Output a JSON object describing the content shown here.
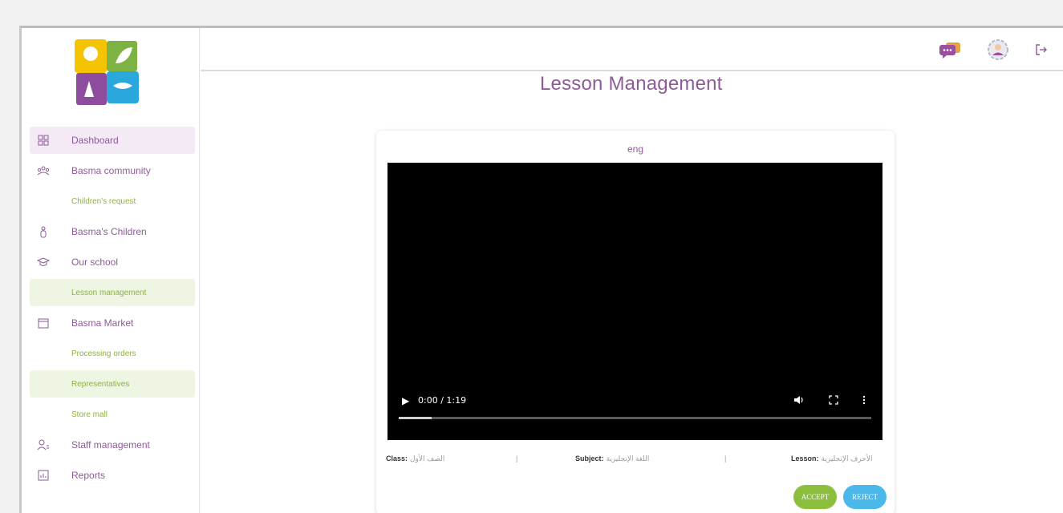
{
  "colors": {
    "brand_purple": "#8e5a98",
    "brand_green": "#8db33a",
    "accept": "#8bbf3d",
    "reject": "#4ab8e8"
  },
  "sidebar": {
    "logo": "bosma-logo",
    "items": [
      {
        "label": "Dashboard",
        "icon": "dashboard-icon",
        "sub": false,
        "active": true
      },
      {
        "label": "Basma community",
        "icon": "community-icon",
        "sub": false
      },
      {
        "label": "Children's request",
        "sub": true
      },
      {
        "label": "Basma's Children",
        "icon": "child-icon",
        "sub": false
      },
      {
        "label": "Our school",
        "icon": "school-icon",
        "sub": false
      },
      {
        "label": "Lesson management",
        "sub": true,
        "active": true
      },
      {
        "label": "Basma Market",
        "icon": "market-icon",
        "sub": false
      },
      {
        "label": "Processing orders",
        "sub": true
      },
      {
        "label": "Representatives",
        "sub": true,
        "active": true
      },
      {
        "label": "Store mall",
        "sub": true
      },
      {
        "label": "Staff management",
        "icon": "staff-icon",
        "sub": false
      },
      {
        "label": "Reports",
        "icon": "reports-icon",
        "sub": false
      }
    ]
  },
  "topbar": {
    "icons": [
      "chat-icon",
      "profile-settings-icon",
      "logout-icon"
    ]
  },
  "page": {
    "title": "Lesson Management"
  },
  "lesson": {
    "title": "eng",
    "video": {
      "time": "0:00 / 1:19",
      "progress": 0.07
    },
    "meta": {
      "class_label": "Class:",
      "class_value": "الصف الأول",
      "subject_label": "Subject:",
      "subject_value": "اللغة الإنجليزية",
      "lesson_label": "Lesson:",
      "lesson_value": "الأحرف الإنجليزية",
      "separator": "|"
    },
    "accept_label": "ACCEPT",
    "reject_label": "REJECT"
  }
}
